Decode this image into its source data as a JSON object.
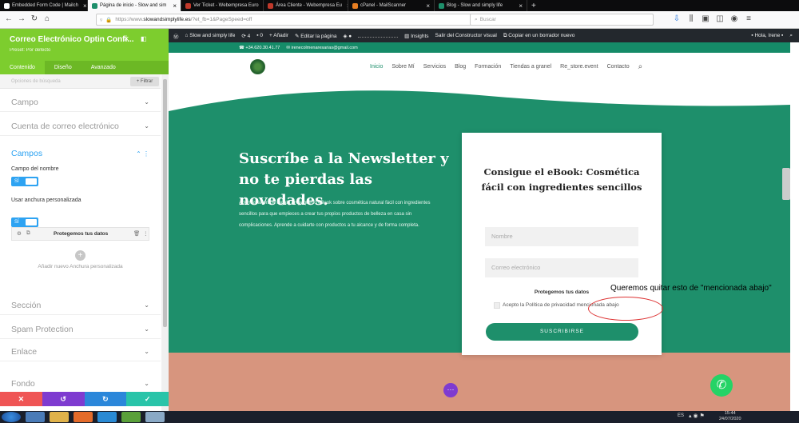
{
  "browser": {
    "tabs": [
      {
        "label": "Embedded Form Code | Mailch",
        "color": "#fff"
      },
      {
        "label": "Página de inicio - Slow and sim",
        "color": "#1e8f6b"
      },
      {
        "label": "Ver Ticket - Webempresa Euro",
        "color": "#c0392b"
      },
      {
        "label": "Área Cliente - Webempresa Eu",
        "color": "#c0392b"
      },
      {
        "label": "cPanel - MailScanner",
        "color": "#e67e22"
      },
      {
        "label": "Blog - Slow and simply life",
        "color": "#1e8f6b"
      }
    ],
    "url_prefix": "https://www.",
    "url_domain": "slowandsimplylife.es",
    "url_suffix": "/?et_fb=1&PageSpeed=off",
    "search_placeholder": "Buscar",
    "more_glyph": "···"
  },
  "wpbar": {
    "site": "Slow and simply life",
    "updates": "4",
    "comments": "0",
    "add": "Añadir",
    "edit": "Editar la página",
    "insights": "Insights",
    "exit": "Salir del Constructor visual",
    "copy": "Copiar en un borrador nuevo",
    "greeting": "Hola, Irene"
  },
  "panel": {
    "title": "Correo Electrónico Optin Confi...",
    "preset": "Preset: Por defecto",
    "tabs": [
      "Contenido",
      "Diseño",
      "Avanzado"
    ],
    "search_placeholder": "Opciones de búsqueda",
    "filter": "+ Filtrar",
    "sections": {
      "campo": "Campo",
      "cuenta": "Cuenta de correo electrónico",
      "campos": "Campos",
      "seccion": "Sección",
      "spam": "Spam Protection",
      "enlace": "Enlace",
      "fondo": "Fondo"
    },
    "campo_nombre_label": "Campo del nombre",
    "toggle_on": "SÍ",
    "anchura_label": "Usar anchura personalizada",
    "item_label": "Protegemos tus datos",
    "add_label": "Añadir nuevo Anchura personalizada",
    "footer": [
      "✕",
      "↺",
      "↻",
      "✓"
    ]
  },
  "site": {
    "phone": "+34.620.30.41.77",
    "email": "irenecolmenaresarias@gmail.com",
    "menu": [
      "Inicio",
      "Sobre Mí",
      "Servicios",
      "Blog",
      "Formación",
      "Tiendas a granel",
      "Re_store.event",
      "Contacto"
    ],
    "hero_title": "Suscríbe a la Newsletter y no te pierdas las novedades.",
    "hero_text": "Además ahora te regalo un pequeño eBook sobre cosmética natural fácil con ingredientes sencillos para que empieces a crear tus propios productos de belleza en casa sin complicaciones. Aprende a cuidarte con productos a tu alcance y de forma completa.",
    "card_title": "Consigue el eBook: Cosmética fácil con ingredientes sencillos",
    "name_placeholder": "Nombre",
    "email_placeholder": "Correo electrónico",
    "protect": "Protegemos tus datos",
    "privacy": "Acepto la Política de privacidad mencionada abajo",
    "submit": "SUSCRIBIRSE"
  },
  "annotation": "Queremos quitar esto de \"mencionada abajo\"",
  "taskbar": {
    "lang": "ES",
    "time": "15:44",
    "date": "24/07/2020"
  },
  "colors": {
    "green": "#1e8f6b",
    "panel": "#7dcd2e",
    "salmon": "#d7957e"
  }
}
